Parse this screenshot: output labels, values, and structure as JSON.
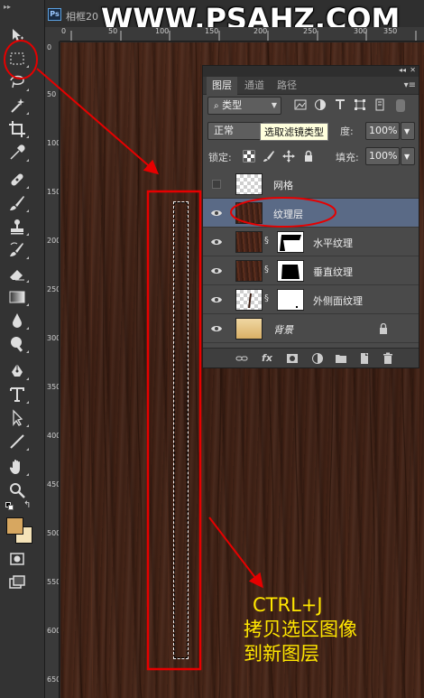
{
  "doc_tab": {
    "badge": "Ps",
    "title": "相框20"
  },
  "watermark": "WWW.PSAHZ.COM",
  "ruler": {
    "top_labels": [
      "0",
      "50",
      "100",
      "150",
      "200",
      "250",
      "300",
      "350"
    ],
    "left_labels": [
      "0",
      "50",
      "100",
      "150",
      "200",
      "250",
      "300",
      "350",
      "400",
      "450",
      "500",
      "550",
      "600",
      "650"
    ]
  },
  "toolbar": {
    "tools": [
      "move-tool",
      "rectangular-marquee-tool",
      "lasso-tool",
      "magic-wand-tool",
      "crop-tool",
      "eyedropper-tool",
      "spot-healing-brush-tool",
      "brush-tool",
      "clone-stamp-tool",
      "history-brush-tool",
      "eraser-tool",
      "gradient-tool",
      "blur-tool",
      "dodge-tool",
      "pen-tool",
      "type-tool",
      "path-selection-tool",
      "line-tool",
      "hand-tool",
      "zoom-tool"
    ],
    "foreground_color": "#d7a760",
    "background_color": "#f5e3b8"
  },
  "layers_panel": {
    "tabs": [
      "图层",
      "通道",
      "路径"
    ],
    "active_tab": "图层",
    "filter_kind": "类型",
    "tooltip": "选取滤镜类型",
    "blend_mode": "正常",
    "opacity_label": "度:",
    "opacity_value": "100%",
    "lock_label": "锁定:",
    "fill_label": "填充:",
    "fill_value": "100%",
    "layers": [
      {
        "name": "网格",
        "visible": false,
        "thumb": "checker",
        "selected": false
      },
      {
        "name": "纹理层",
        "visible": true,
        "thumb": "wood",
        "selected": true
      },
      {
        "name": "水平纹理",
        "visible": true,
        "thumb": "wood",
        "mask": "mask",
        "selected": false
      },
      {
        "name": "垂直纹理",
        "visible": true,
        "thumb": "wood",
        "mask": "mask",
        "selected": false
      },
      {
        "name": "外侧面纹理",
        "visible": true,
        "thumb": "checker",
        "mask": "mask",
        "selected": false
      },
      {
        "name": "背景",
        "visible": true,
        "thumb": "tan",
        "selected": false,
        "locked": true,
        "italic": true
      }
    ],
    "bottom_icons": [
      "link-layers-icon",
      "fx-icon",
      "add-mask-icon",
      "adjustment-layer-icon",
      "group-folder-icon",
      "new-layer-icon",
      "delete-layer-icon"
    ],
    "fx_label": "fx"
  },
  "annotation": {
    "shortcut": "CTRL+J",
    "line1": "拷贝选区图像",
    "line2": "到新图层",
    "color": "#ffe600",
    "mark_color": "#e60000"
  }
}
